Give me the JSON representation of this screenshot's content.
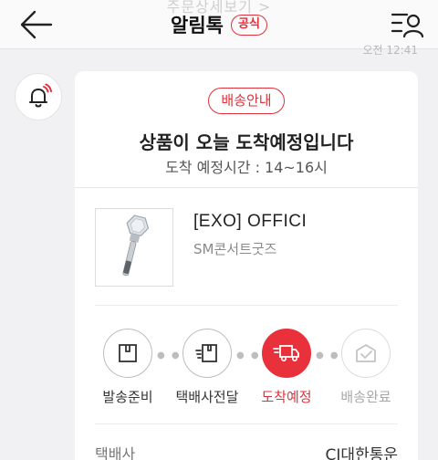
{
  "header": {
    "ghost_text": "주문상세보기 >",
    "title": "알림톡",
    "badge": "공식",
    "time": "오전 12:41"
  },
  "message": {
    "badge": "배송안내",
    "headline": "상품이 오늘 도착예정입니다",
    "subline": "도착 예정시간 : 14~16시"
  },
  "product": {
    "name": "[EXO] OFFICI",
    "sub": "SM콘서트굿즈"
  },
  "steps": [
    {
      "label": "발송준비",
      "icon": "box-icon",
      "state": "done"
    },
    {
      "label": "택배사전달",
      "icon": "package-moving-icon",
      "state": "done"
    },
    {
      "label": "도착예정",
      "icon": "truck-icon",
      "state": "active"
    },
    {
      "label": "배송완료",
      "icon": "open-box-icon",
      "state": "future"
    }
  ],
  "info": {
    "label": "택배사",
    "value": "CJ대한통운"
  },
  "colors": {
    "accent": "#e0323c",
    "background": "#f1f1f3"
  }
}
